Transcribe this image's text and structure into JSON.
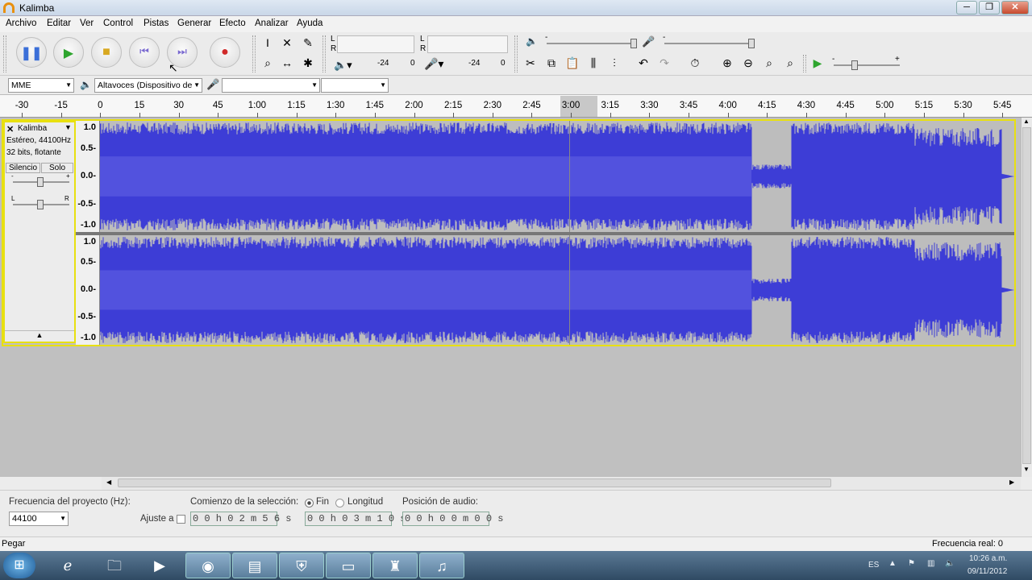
{
  "window": {
    "title": "Kalimba",
    "min": "─",
    "max": "❐",
    "close": "✕"
  },
  "menu": [
    "Archivo",
    "Editar",
    "Ver",
    "Control",
    "Pistas",
    "Generar",
    "Efecto",
    "Analizar",
    "Ayuda"
  ],
  "transport": {
    "pause_icon": "pause-icon",
    "play_icon": "play-icon",
    "stop_icon": "stop-icon",
    "skip_start_icon": "skip-to-start-icon",
    "skip_end_icon": "skip-to-end-icon",
    "record_icon": "record-icon"
  },
  "meters": {
    "L": "L",
    "R": "R",
    "play_db": "-24",
    "zero": "0",
    "rec_db": "-24",
    "zero2": "0"
  },
  "mixer": {
    "minus": "-",
    "plus": "+"
  },
  "devices": {
    "host": "MME",
    "output": "Altavoces (Dispositivo de",
    "input": "",
    "channels": ""
  },
  "ruler": {
    "labels": [
      "-30",
      "-15",
      "0",
      "15",
      "30",
      "45",
      "1:00",
      "1:15",
      "1:30",
      "1:45",
      "2:00",
      "2:15",
      "2:30",
      "2:45",
      "3:00",
      "3:15",
      "3:30",
      "3:45",
      "4:00",
      "4:15",
      "4:30",
      "4:45",
      "5:00",
      "5:15",
      "5:30",
      "5:45"
    ]
  },
  "track": {
    "name": "Kalimba",
    "format": "Estéreo, 44100Hz",
    "bits": "32 bits, flotante",
    "mute": "Silencio",
    "solo": "Solo",
    "gain_minus": "-",
    "gain_plus": "+",
    "pan_l": "L",
    "pan_r": "R",
    "collapse": "▲",
    "channel1_scale": [
      "1.0",
      "0.5-",
      "0.0-",
      "-0.5-",
      "-1.0"
    ],
    "channel2_scale": [
      "1.0",
      "0.5-",
      "0.0-",
      "-0.5-",
      "-1.0"
    ],
    "waveform_color": "#3d3dd6"
  },
  "selection_bar": {
    "rate_label": "Frecuencia del proyecto (Hz):",
    "rate_value": "44100",
    "snap_label": "Ajuste a",
    "start_label": "Comienzo de la selección:",
    "start_value": "0 0 h 0 2 m 5 6 s",
    "end_radio": "Fin",
    "length_radio": "Longitud",
    "end_value": "0 0 h 0 3 m 1 0 s",
    "audio_pos_label": "Posición de audio:",
    "audio_pos_value": "0 0 h 0 0 m 0 0 s"
  },
  "status": {
    "left": "Pegar",
    "right": "Frecuencia real: 0"
  },
  "taskbar": {
    "lang": "ES",
    "time": "10:26 a.m.",
    "date": "09/11/2012"
  }
}
